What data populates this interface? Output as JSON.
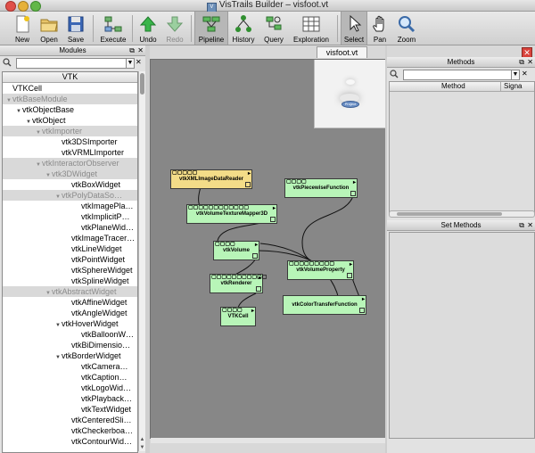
{
  "window": {
    "title": "VisTrails Builder – visfoot.vt"
  },
  "toolbar": {
    "new": "New",
    "open": "Open",
    "save": "Save",
    "execute": "Execute",
    "undo": "Undo",
    "redo": "Redo",
    "pipeline": "Pipeline",
    "history": "History",
    "query": "Query",
    "exploration": "Exploration",
    "select": "Select",
    "pan": "Pan",
    "zoom": "Zoom"
  },
  "modules_panel": {
    "title": "Modules",
    "tree_header": "VTK",
    "items": [
      {
        "label": "VTKCell",
        "indent": 0,
        "grey": false,
        "tri": ""
      },
      {
        "label": "vtkBaseModule",
        "indent": 0,
        "grey": true,
        "tri": "▼"
      },
      {
        "label": "vtkObjectBase",
        "indent": 1,
        "grey": false,
        "tri": "▼"
      },
      {
        "label": "vtkObject",
        "indent": 2,
        "grey": false,
        "tri": "▼"
      },
      {
        "label": "vtkImporter",
        "indent": 3,
        "grey": true,
        "tri": "▼"
      },
      {
        "label": "vtk3DSImporter",
        "indent": 5,
        "grey": false,
        "tri": ""
      },
      {
        "label": "vtkVRMLImporter",
        "indent": 5,
        "grey": false,
        "tri": ""
      },
      {
        "label": "vtkInteractorObserver",
        "indent": 3,
        "grey": true,
        "tri": "▼"
      },
      {
        "label": "vtk3DWidget",
        "indent": 4,
        "grey": true,
        "tri": "▼"
      },
      {
        "label": "vtkBoxWidget",
        "indent": 6,
        "grey": false,
        "tri": ""
      },
      {
        "label": "vtkPolyDataSo…",
        "indent": 5,
        "grey": true,
        "tri": "▼"
      },
      {
        "label": "vtkImagePla…",
        "indent": 7,
        "grey": false,
        "tri": ""
      },
      {
        "label": "vtkImplicitP…",
        "indent": 7,
        "grey": false,
        "tri": ""
      },
      {
        "label": "vtkPlaneWid…",
        "indent": 7,
        "grey": false,
        "tri": ""
      },
      {
        "label": "vtkImageTracer…",
        "indent": 6,
        "grey": false,
        "tri": ""
      },
      {
        "label": "vtkLineWidget",
        "indent": 6,
        "grey": false,
        "tri": ""
      },
      {
        "label": "vtkPointWidget",
        "indent": 6,
        "grey": false,
        "tri": ""
      },
      {
        "label": "vtkSphereWidget",
        "indent": 6,
        "grey": false,
        "tri": ""
      },
      {
        "label": "vtkSplineWidget",
        "indent": 6,
        "grey": false,
        "tri": ""
      },
      {
        "label": "vtkAbstractWidget",
        "indent": 4,
        "grey": true,
        "tri": "▼"
      },
      {
        "label": "vtkAffineWidget",
        "indent": 6,
        "grey": false,
        "tri": ""
      },
      {
        "label": "vtkAngleWidget",
        "indent": 6,
        "grey": false,
        "tri": ""
      },
      {
        "label": "vtkHoverWidget",
        "indent": 5,
        "grey": false,
        "tri": "▼"
      },
      {
        "label": "vtkBalloonW…",
        "indent": 7,
        "grey": false,
        "tri": ""
      },
      {
        "label": "vtkBiDimensio…",
        "indent": 6,
        "grey": false,
        "tri": ""
      },
      {
        "label": "vtkBorderWidget",
        "indent": 5,
        "grey": false,
        "tri": "▼"
      },
      {
        "label": "vtkCamera…",
        "indent": 7,
        "grey": false,
        "tri": ""
      },
      {
        "label": "vtkCaption…",
        "indent": 7,
        "grey": false,
        "tri": ""
      },
      {
        "label": "vtkLogoWid…",
        "indent": 7,
        "grey": false,
        "tri": ""
      },
      {
        "label": "vtkPlayback…",
        "indent": 7,
        "grey": false,
        "tri": ""
      },
      {
        "label": "vtkTextWidget",
        "indent": 7,
        "grey": false,
        "tri": ""
      },
      {
        "label": "vtkCenteredSli…",
        "indent": 6,
        "grey": false,
        "tri": ""
      },
      {
        "label": "vtkCheckerboa…",
        "indent": 6,
        "grey": false,
        "tri": ""
      },
      {
        "label": "vtkContourWid…",
        "indent": 6,
        "grey": false,
        "tri": ""
      }
    ]
  },
  "canvas": {
    "tab_title": "visfoot.vt",
    "minimap_label": "Project",
    "modules": [
      {
        "name": "vtkXMLImageDataReader",
        "color": "yellow",
        "ports": 5
      },
      {
        "name": "vtkPiecewiseFunction",
        "color": "green",
        "ports": 4
      },
      {
        "name": "vtkVolumeTextureMapper3D",
        "color": "green",
        "ports": 12
      },
      {
        "name": "vtkVolume",
        "color": "green",
        "ports": 4
      },
      {
        "name": "vtkVolumeProperty",
        "color": "green",
        "ports": 9
      },
      {
        "name": "vtkRenderer",
        "color": "green",
        "ports": 11
      },
      {
        "name": "vtkColorTransferFunction",
        "color": "green",
        "ports": 0
      },
      {
        "name": "VTKCell",
        "color": "green",
        "ports": 4
      }
    ]
  },
  "methods_panel": {
    "title": "Methods",
    "col_method": "Method",
    "col_signature": "Signa"
  },
  "set_methods_panel": {
    "title": "Set Methods"
  },
  "colors": {
    "module_green": "#b8f5b8",
    "module_yellow": "#f3dc88",
    "canvas_bg": "#878787"
  }
}
